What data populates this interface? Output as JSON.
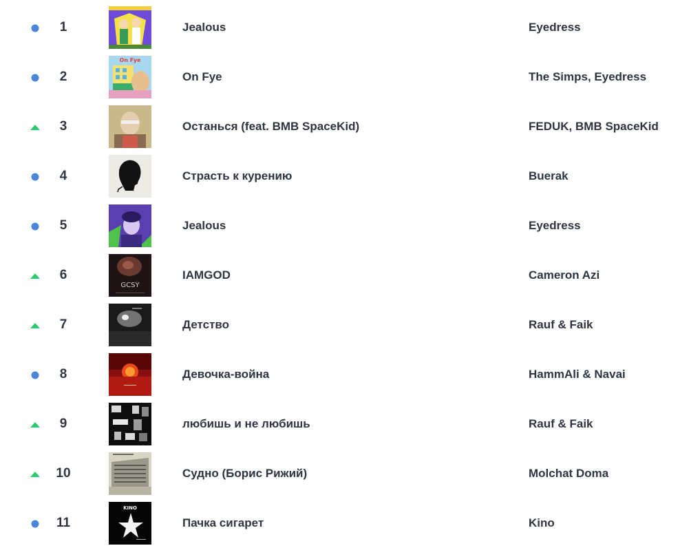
{
  "colors": {
    "trend_same": "#4a86d8",
    "trend_up": "#2ecc71",
    "text": "#2e3440"
  },
  "tracks": [
    {
      "rank": "1",
      "title": "Jealous",
      "artist": "Eyedress",
      "trend": "same",
      "cover_icon": "album-cover-cartoon-yellow"
    },
    {
      "rank": "2",
      "title": "On Fye",
      "artist": "The Simps, Eyedress",
      "trend": "same",
      "cover_icon": "album-cover-cartoon-building"
    },
    {
      "rank": "3",
      "title": "Останься (feat. BMB SpaceKid)",
      "artist": "FEDUK, BMB SpaceKid",
      "trend": "up",
      "cover_icon": "album-cover-portrait"
    },
    {
      "rank": "4",
      "title": "Страсть к курению",
      "artist": "Buerak",
      "trend": "same",
      "cover_icon": "album-cover-silhouette"
    },
    {
      "rank": "5",
      "title": "Jealous",
      "artist": "Eyedress",
      "trend": "same",
      "cover_icon": "album-cover-purple-green"
    },
    {
      "rank": "6",
      "title": "IAMGOD",
      "artist": "Cameron Azi",
      "trend": "up",
      "cover_icon": "album-cover-dark-portrait"
    },
    {
      "rank": "7",
      "title": "Детство",
      "artist": "Rauf & Faik",
      "trend": "up",
      "cover_icon": "album-cover-dark-grey"
    },
    {
      "rank": "8",
      "title": "Девочка-война",
      "artist": "HammAli & Navai",
      "trend": "same",
      "cover_icon": "album-cover-red-sun"
    },
    {
      "rank": "9",
      "title": "любишь и не любишь",
      "artist": "Rauf & Faik",
      "trend": "up",
      "cover_icon": "album-cover-collage"
    },
    {
      "rank": "10",
      "title": "Судно (Борис Рижий)",
      "artist": "Molchat Doma",
      "trend": "up",
      "cover_icon": "album-cover-building-photo"
    },
    {
      "rank": "11",
      "title": "Пачка сигарет",
      "artist": "Kino",
      "trend": "same",
      "cover_icon": "album-cover-kino-star"
    }
  ],
  "cover_logo_text": {
    "row2": "On Fye",
    "row6": "GCSY",
    "row11": "KINO"
  }
}
